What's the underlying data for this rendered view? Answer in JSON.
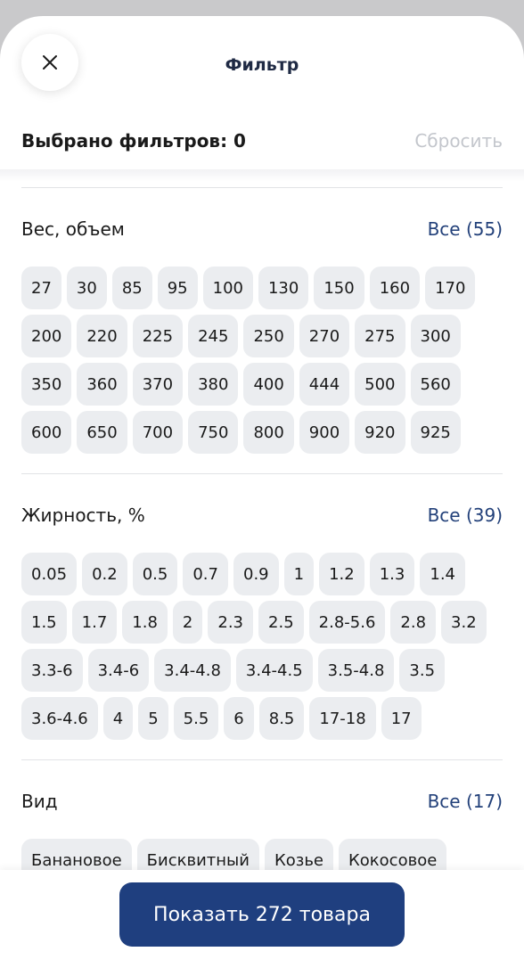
{
  "header": {
    "title": "Фильтр"
  },
  "summary": {
    "label": "Выбрано фильтров: 0",
    "reset_label": "Сбросить"
  },
  "sections": [
    {
      "title": "Вес, объем",
      "all_label": "Все (55)",
      "options": [
        "27",
        "30",
        "85",
        "95",
        "100",
        "130",
        "150",
        "160",
        "170",
        "200",
        "220",
        "225",
        "245",
        "250",
        "270",
        "275",
        "300",
        "350",
        "360",
        "370",
        "380",
        "400",
        "444",
        "500",
        "560",
        "600",
        "650",
        "700",
        "750",
        "800",
        "900",
        "920",
        "925"
      ]
    },
    {
      "title": "Жирность, %",
      "all_label": "Все (39)",
      "options": [
        "0.05",
        "0.2",
        "0.5",
        "0.7",
        "0.9",
        "1",
        "1.2",
        "1.3",
        "1.4",
        "1.5",
        "1.7",
        "1.8",
        "2",
        "2.3",
        "2.5",
        "2.8-5.6",
        "2.8",
        "3.2",
        "3.3-6",
        "3.4-6",
        "3.4-4.8",
        "3.4-4.5",
        "3.5-4.8",
        "3.5",
        "3.6-4.6",
        "4",
        "5",
        "5.5",
        "6",
        "8.5",
        "17-18",
        "17"
      ]
    },
    {
      "title": "Вид",
      "all_label": "Все (17)",
      "options": [
        "Банановое",
        "Бисквитный",
        "Козье",
        "Кокосовое"
      ]
    }
  ],
  "footer": {
    "show_label": "Показать 272 товара"
  },
  "colors": {
    "accent": "#1f3f7f",
    "link": "#23417a",
    "chip_bg": "#ebedf0"
  }
}
